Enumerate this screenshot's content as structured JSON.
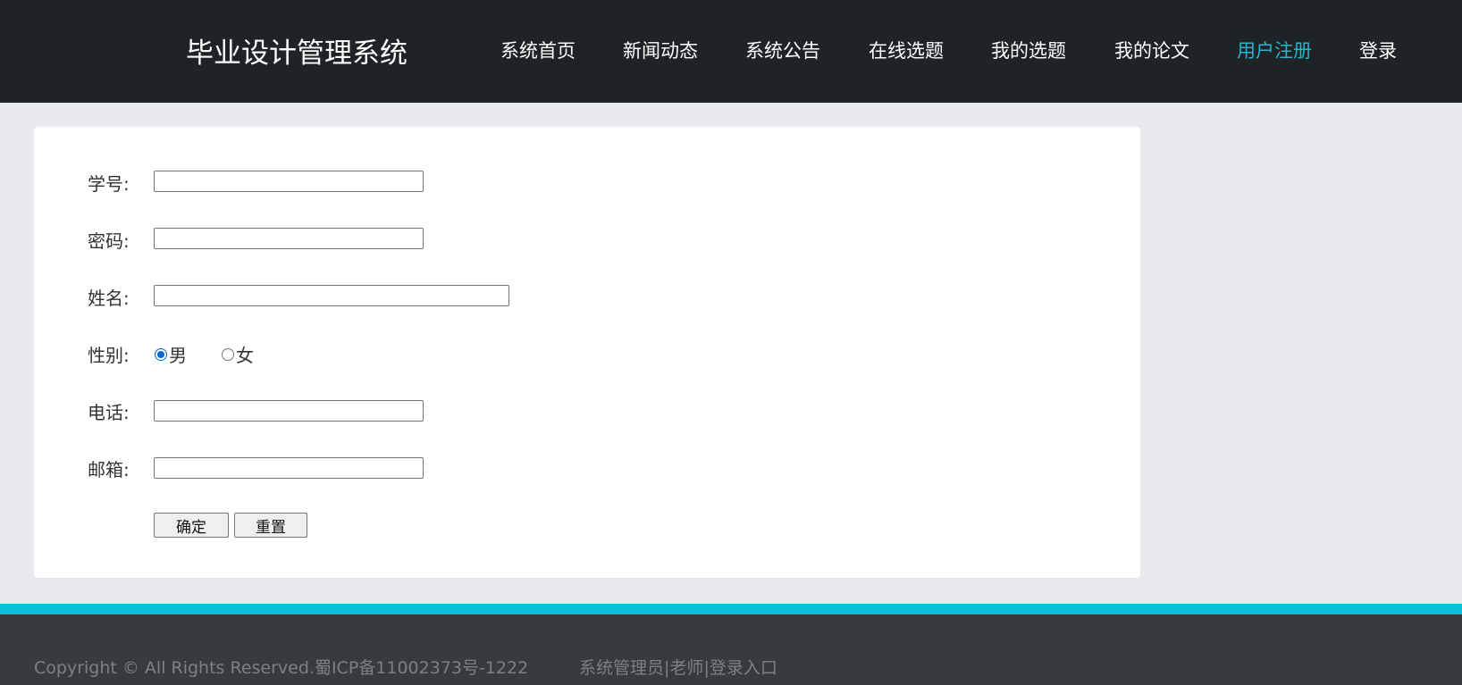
{
  "header": {
    "brand": "毕业设计管理系统",
    "nav": [
      {
        "label": "系统首页"
      },
      {
        "label": "新闻动态"
      },
      {
        "label": "系统公告"
      },
      {
        "label": "在线选题"
      },
      {
        "label": "我的选题"
      },
      {
        "label": "我的论文"
      },
      {
        "label": "用户注册",
        "active": true
      },
      {
        "label": "登录"
      }
    ]
  },
  "form": {
    "student_id_label": "学号:",
    "student_id_value": "",
    "password_label": "密码:",
    "password_value": "",
    "name_label": "姓名:",
    "name_value": "",
    "gender_label": "性别:",
    "gender_options": [
      "男",
      "女"
    ],
    "gender_selected": "男",
    "phone_label": "电话:",
    "phone_value": "",
    "email_label": "邮箱:",
    "email_value": "",
    "submit_label": "确定",
    "reset_label": "重置"
  },
  "footer": {
    "copyright": "Copyright © All Rights Reserved.蜀ICP备11002373号-1222",
    "links": [
      "系统管理员",
      "老师",
      "登录入口"
    ],
    "separator": "|"
  },
  "colors": {
    "header_bg": "#1e2326",
    "nav_active": "#21b5cf",
    "page_bg": "#e8e9ec",
    "accent_stripe": "#0abfd8",
    "footer_bg": "#373b3f"
  }
}
